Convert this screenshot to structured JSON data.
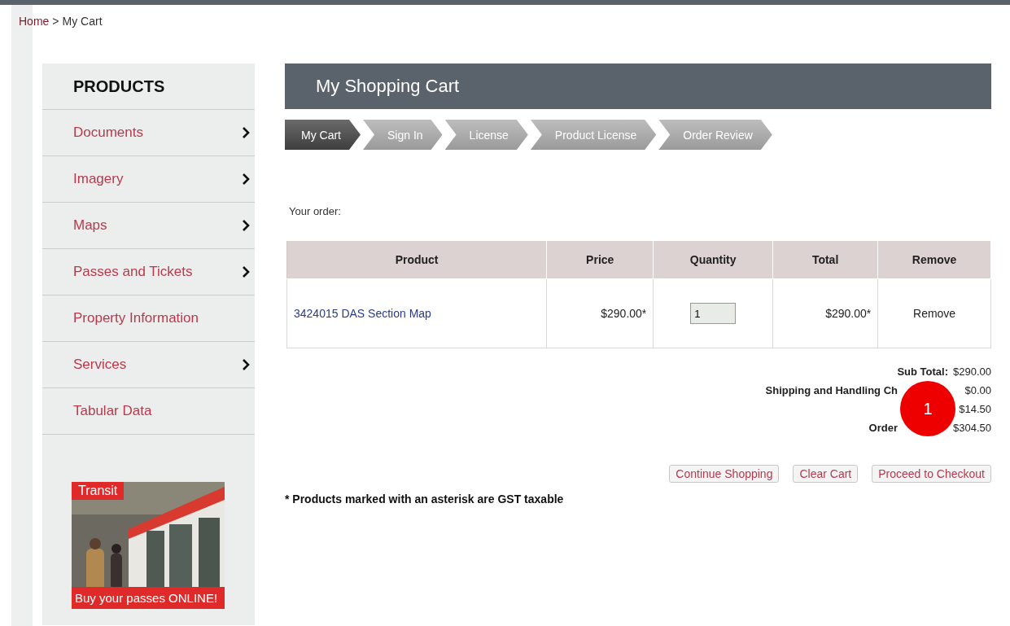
{
  "breadcrumb": {
    "link": "Home",
    "separator": ">",
    "current": "My Cart"
  },
  "sidebar": {
    "title": "PRODUCTS",
    "items": [
      {
        "label": "Documents",
        "has_submenu": true
      },
      {
        "label": "Imagery",
        "has_submenu": true
      },
      {
        "label": "Maps",
        "has_submenu": true
      },
      {
        "label": "Passes and Tickets",
        "has_submenu": true
      },
      {
        "label": "Property Information",
        "has_submenu": false
      },
      {
        "label": "Services",
        "has_submenu": true
      },
      {
        "label": "Tabular Data",
        "has_submenu": false
      }
    ],
    "banner": {
      "kind": "picture",
      "title": "Transit",
      "caption": "Buy your passes ONLINE!"
    }
  },
  "header": {
    "title": "My Shopping Cart"
  },
  "steps": [
    {
      "label": "My Cart",
      "selected": true
    },
    {
      "label": "Sign In",
      "selected": false
    },
    {
      "label": "License",
      "selected": false
    },
    {
      "label": "Product License",
      "selected": false
    },
    {
      "label": "Order Review",
      "selected": false
    }
  ],
  "order_label": "Your order:",
  "table": {
    "columns": [
      "Product",
      "Price",
      "Quantity",
      "Total",
      "Remove"
    ],
    "rows": [
      {
        "product": "3424015 DAS Section Map",
        "price": "$290.00*",
        "quantity": "1",
        "total": "$290.00*",
        "remove": "Remove"
      }
    ]
  },
  "totals": [
    {
      "label": "Sub Total:",
      "value": "$290.00"
    },
    {
      "label": "Shipping and Handling Ch",
      "value": "$0.00"
    },
    {
      "value": "$14.50"
    },
    {
      "label": "Order",
      "value": "$304.50"
    }
  ],
  "callout": {
    "number": "1"
  },
  "buttons": [
    "Continue Shopping",
    "Clear Cart",
    "Proceed to Checkout"
  ],
  "footnote": "* Products marked with an asterisk are GST taxable"
}
